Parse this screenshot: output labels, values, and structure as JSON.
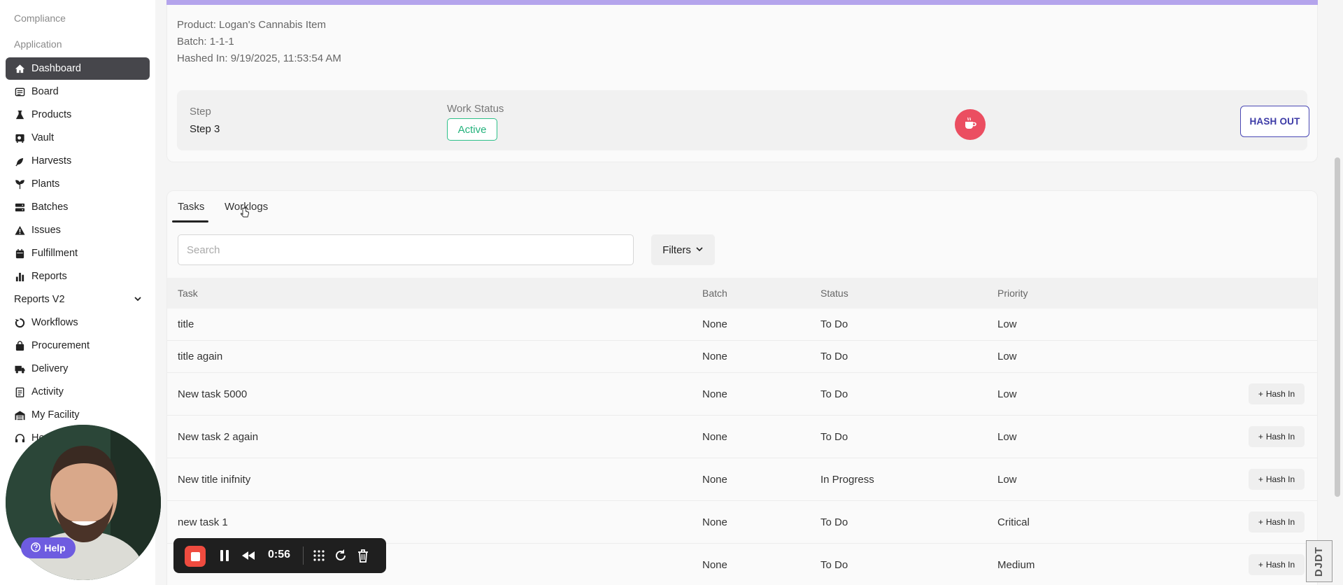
{
  "sidebar": {
    "section_compliance": "Compliance",
    "section_application": "Application",
    "items": [
      {
        "label": "Dashboard",
        "icon": "home-icon"
      },
      {
        "label": "Board",
        "icon": "board-icon"
      },
      {
        "label": "Products",
        "icon": "flask-icon"
      },
      {
        "label": "Vault",
        "icon": "vault-icon"
      },
      {
        "label": "Harvests",
        "icon": "leaf-icon"
      },
      {
        "label": "Plants",
        "icon": "sprout-icon"
      },
      {
        "label": "Batches",
        "icon": "layers-icon"
      },
      {
        "label": "Issues",
        "icon": "warning-icon"
      },
      {
        "label": "Fulfillment",
        "icon": "calendar-icon"
      },
      {
        "label": "Reports",
        "icon": "bar-chart-icon"
      },
      {
        "label": "Reports V2"
      },
      {
        "label": "Workflows",
        "icon": "recycle-icon"
      },
      {
        "label": "Procurement",
        "icon": "bag-icon"
      },
      {
        "label": "Delivery",
        "icon": "truck-icon"
      },
      {
        "label": "Activity",
        "icon": "clipboard-icon"
      },
      {
        "label": "My Facility",
        "icon": "warehouse-icon"
      },
      {
        "label": "He",
        "icon": "headset-icon"
      }
    ]
  },
  "info": {
    "product": "Product: Logan's Cannabis Item",
    "batch": "Batch: 1-1-1",
    "hashed_in": "Hashed In: 9/19/2025, 11:53:54 AM",
    "step_label": "Step",
    "step_value": "Step 3",
    "work_status_label": "Work Status",
    "work_status_value": "Active",
    "hash_out_label": "HASH OUT"
  },
  "tasks": {
    "tabs": [
      "Tasks",
      "Worklogs"
    ],
    "search_placeholder": "Search",
    "filters_label": "Filters",
    "columns": [
      "Task",
      "Batch",
      "Status",
      "Priority"
    ],
    "hash_in_label": "Hash In",
    "rows": [
      {
        "task": "title",
        "batch": "None",
        "status": "To Do",
        "priority": "Low",
        "hash_in": false
      },
      {
        "task": "title again",
        "batch": "None",
        "status": "To Do",
        "priority": "Low",
        "hash_in": false
      },
      {
        "task": "New task 5000",
        "batch": "None",
        "status": "To Do",
        "priority": "Low",
        "hash_in": true
      },
      {
        "task": "New task 2 again",
        "batch": "None",
        "status": "To Do",
        "priority": "Low",
        "hash_in": true
      },
      {
        "task": "New title inifnity",
        "batch": "None",
        "status": "In Progress",
        "priority": "Low",
        "hash_in": true
      },
      {
        "task": "new task 1",
        "batch": "None",
        "status": "To Do",
        "priority": "Critical",
        "hash_in": true
      },
      {
        "task": "",
        "batch": "None",
        "status": "To Do",
        "priority": "Medium",
        "hash_in": true
      }
    ]
  },
  "overlay": {
    "help_label": "Help",
    "rec_time": "0:56",
    "logo_text": "DJDT"
  },
  "colors": {
    "accent_bar": "#b4a4ec",
    "active_green": "#24b27c",
    "hash_out_border": "#4a48b4",
    "cup_button": "#eb4e61",
    "sidebar_active": "#46464b"
  }
}
